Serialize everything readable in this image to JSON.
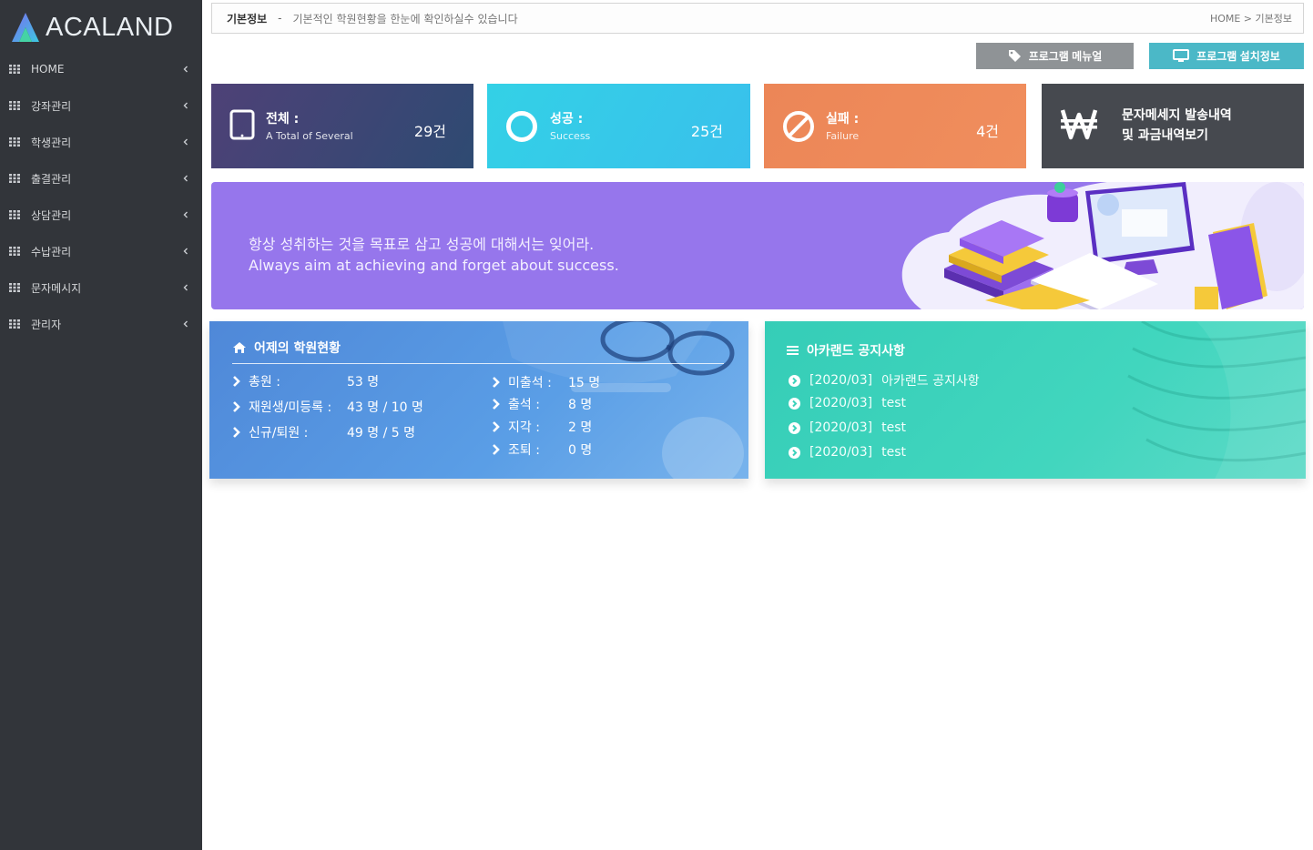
{
  "brand": {
    "name": "ACALAND"
  },
  "sidebar": {
    "items": [
      {
        "label": "HOME"
      },
      {
        "label": "강좌관리"
      },
      {
        "label": "학생관리"
      },
      {
        "label": "출결관리"
      },
      {
        "label": "상담관리"
      },
      {
        "label": "수납관리"
      },
      {
        "label": "문자메시지"
      },
      {
        "label": "관리자"
      }
    ]
  },
  "header": {
    "title": "기본정보",
    "separator": "-",
    "description": "기본적인 학원현황을 한눈에 확인하실수 있습니다",
    "breadcrumb": "HOME > 기본정보"
  },
  "toolbar": {
    "manual_label": "프로그램 메뉴얼",
    "install_label": "프로그램 설치정보"
  },
  "stats": {
    "total": {
      "title": "전체 :",
      "subtitle": "A Total of Several",
      "value": "29건"
    },
    "success": {
      "title": "성공 :",
      "subtitle": "Success",
      "value": "25건"
    },
    "failure": {
      "title": "실패 :",
      "subtitle": "Failure",
      "value": "4건"
    },
    "sms": {
      "line1": "문자메세지 발송내역",
      "line2": "및 과금내역보기"
    }
  },
  "banner": {
    "quote_ko": "항상 성취하는 것을 목표로 삼고 성공에 대해서는 잊어라.",
    "quote_en": "Always aim at achieving and forget about success."
  },
  "status_panel": {
    "title": "어제의 학원현황",
    "left": [
      {
        "label": "총원 :",
        "value": "53 명"
      },
      {
        "label": "재원생/미등록 :",
        "value": "43 명  /  10 명"
      },
      {
        "label": "신규/퇴원 :",
        "value": "49 명  /  5 명"
      }
    ],
    "right": [
      {
        "label": "미출석 :",
        "value": "15 명"
      },
      {
        "label": "출석 :",
        "value": "8 명"
      },
      {
        "label": "지각 :",
        "value": "2 명"
      },
      {
        "label": "조퇴 :",
        "value": "0 명"
      }
    ]
  },
  "notice_panel": {
    "title": "아카랜드 공지사항",
    "items": [
      {
        "date": "[2020/03]",
        "text": "아카랜드 공지사항"
      },
      {
        "date": "[2020/03]",
        "text": "test"
      },
      {
        "date": "[2020/03]",
        "text": "test"
      },
      {
        "date": "[2020/03]",
        "text": "test"
      }
    ]
  },
  "colors": {
    "sidebar_bg": "#32353a",
    "card_total": "#3e4675",
    "card_success": "#36c9e9",
    "card_failure": "#ed8a5a",
    "card_sms": "#46494f",
    "banner": "#9676ec",
    "panel_status": "#5594de",
    "panel_notice": "#3dd2bb"
  },
  "icons": {
    "logo": "a-triangle-logo",
    "nav": "grid-icon",
    "nav_arrow": "chevron-left-icon",
    "manual": "tag-icon",
    "install": "monitor-icon",
    "total": "tablet-icon",
    "success": "circle-icon",
    "failure": "ban-icon",
    "sms": "won-icon",
    "status": "home-icon",
    "notice": "bars-icon",
    "status_row": "chevron-right-icon",
    "notice_row": "chevron-circle-right-icon"
  }
}
